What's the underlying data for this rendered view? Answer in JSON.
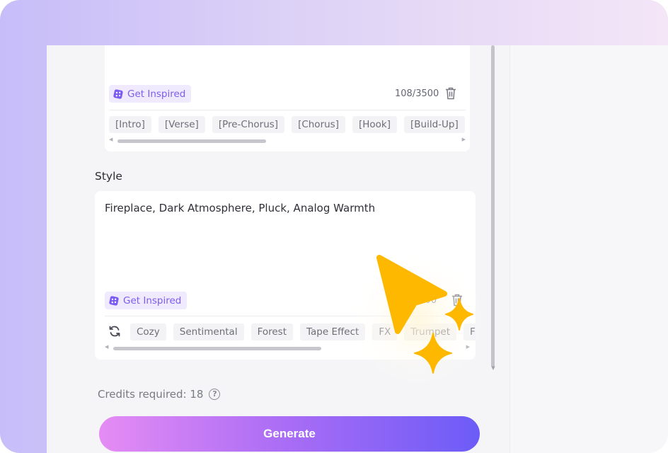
{
  "lyrics": {
    "inspire_label": "Get Inspired",
    "counter": "108/3500",
    "tags": [
      "[Intro]",
      "[Verse]",
      "[Pre-Chorus]",
      "[Chorus]",
      "[Hook]",
      "[Build-Up]"
    ]
  },
  "style": {
    "label": "Style",
    "value": "Fireplace, Dark Atmosphere, Pluck, Analog Warmth",
    "inspire_label": "Get Inspired",
    "counter": "3500",
    "tags": [
      "Cozy",
      "Sentimental",
      "Forest",
      "Tape Effect",
      "FX",
      "Trumpet",
      "F"
    ]
  },
  "credits": {
    "label": "Credits required: 18",
    "help_glyph": "?"
  },
  "generate_label": "Generate",
  "colors": {
    "accent": "#7c5cf0",
    "pointer": "#ffb800",
    "generate_start": "#e58cf4",
    "generate_end": "#6c5cf7"
  }
}
